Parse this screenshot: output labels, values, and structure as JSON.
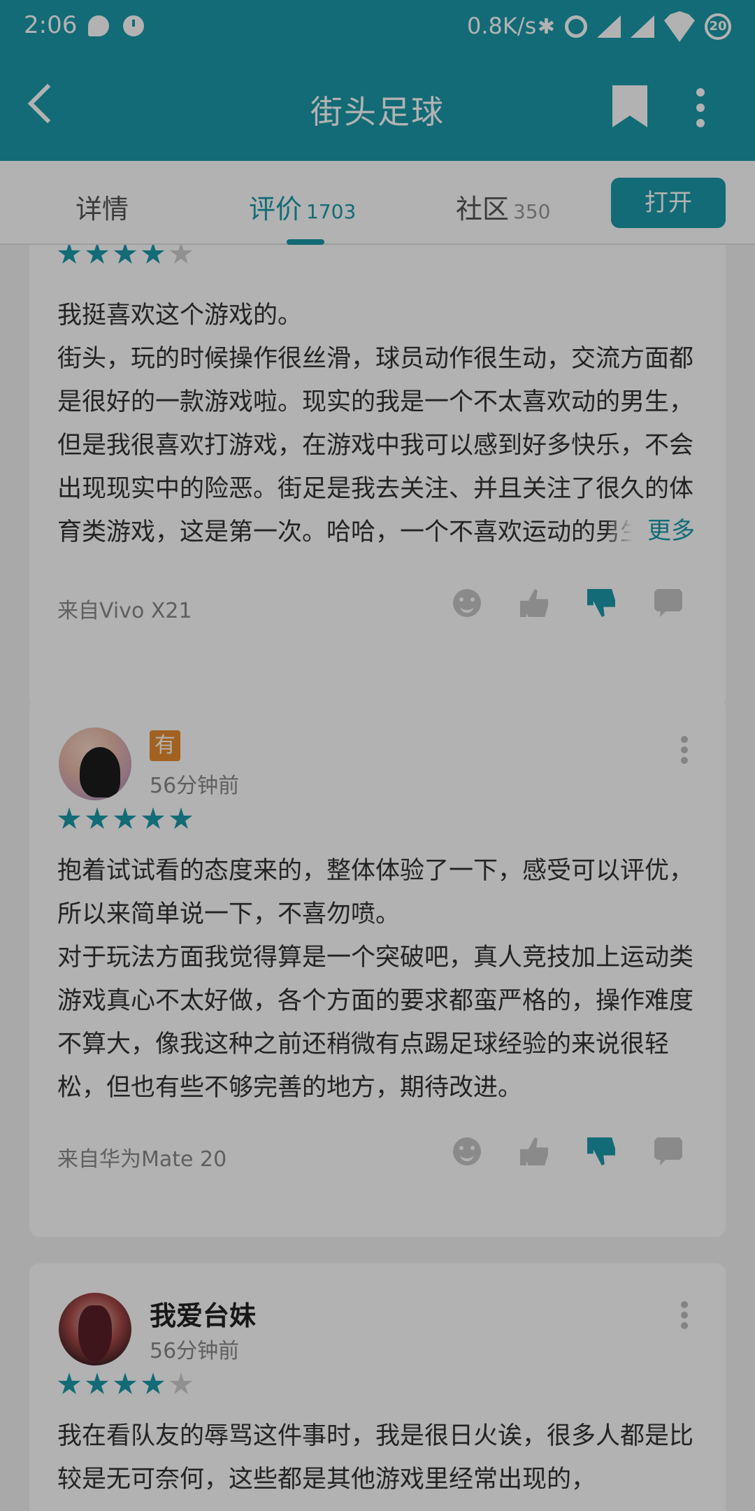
{
  "status_bar": {
    "time": "2:06",
    "network_speed": "0.8K/s",
    "battery": "20"
  },
  "app_bar": {
    "title": "街头足球"
  },
  "tabs": {
    "details": {
      "label": "详情"
    },
    "reviews": {
      "label": "评价",
      "count": "1703"
    },
    "community": {
      "label": "社区",
      "count": "350"
    },
    "open_button": "打开"
  },
  "reviews": [
    {
      "rating": 4,
      "text": "我挺喜欢这个游戏的。\n街头，玩的时候操作很丝滑，球员动作很生动，交流方面都是很好的一款游戏啦。现实的我是一个不太喜欢动的男生，但是我很喜欢打游戏，在游戏中我可以感到好多快乐，不会出现现实中的险恶。街足是我去关注、并且关注了很久的体育类游戏，这是第一次。哈哈，一个不喜欢运动的男生却喜欢这样一个足球游戏，挺",
      "more_label": "更多",
      "device": "来自Vivo X21"
    },
    {
      "user_name": "有",
      "time": "56分钟前",
      "rating": 5,
      "text": "抱着试试看的态度来的，整体体验了一下，感受可以评优，所以来简单说一下，不喜勿喷。\n对于玩法方面我觉得算是一个突破吧，真人竞技加上运动类游戏真心不太好做，各个方面的要求都蛮严格的，操作难度不算大，像我这种之前还稍微有点踢足球经验的来说很轻松，但也有些不够完善的地方，期待改进。",
      "device": "来自华为Mate 20"
    },
    {
      "user_name": "我爱台妹",
      "time": "56分钟前",
      "rating": 4,
      "text": "我在看队友的辱骂这件事时，我是很日火诶，很多人都是比较是无可奈何，这些都是其他游戏里经常出现的，"
    }
  ],
  "colors": {
    "accent": "#1b9aa9",
    "badge": "#e98c2e"
  },
  "icons": [
    "back-icon",
    "bookmark-icon",
    "more-icon",
    "emoji-icon",
    "thumbs-up-icon",
    "thumbs-down-icon",
    "comment-icon",
    "kebab-icon"
  ]
}
